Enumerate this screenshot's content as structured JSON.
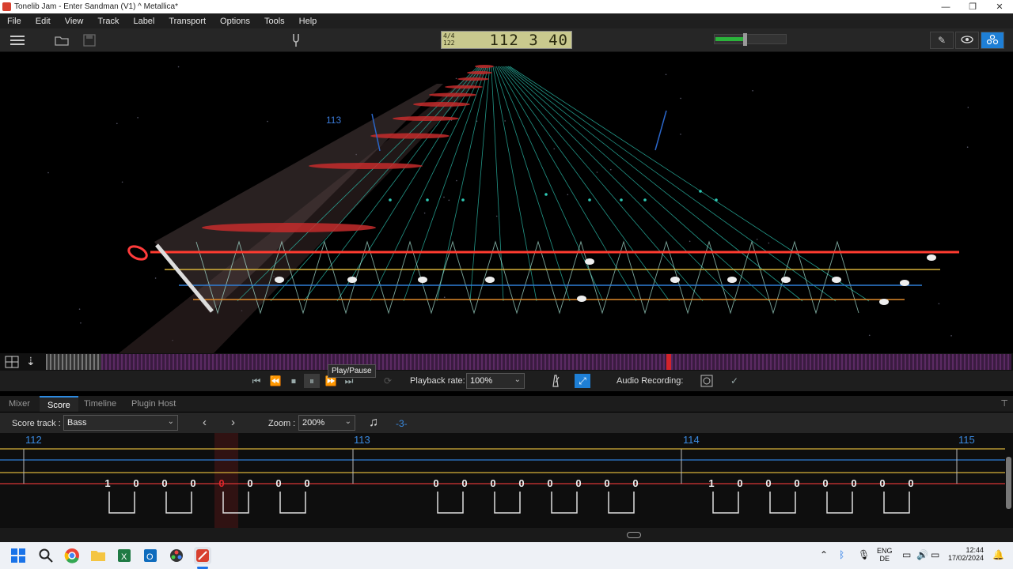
{
  "window": {
    "title": "Tonelib Jam - Enter Sandman (V1) ^ Metallica*"
  },
  "window_controls": {
    "minimize": "—",
    "maximize": "❐",
    "close": "✕"
  },
  "menu": [
    "File",
    "Edit",
    "View",
    "Track",
    "Label",
    "Transport",
    "Options",
    "Tools",
    "Help"
  ],
  "lcd": {
    "time_signature": "4/4",
    "tempo": "122",
    "position": "112 3 40"
  },
  "volume": {
    "level": 0.42
  },
  "view_buttons": [
    "pencil-icon",
    "eye-icon",
    "players-icon"
  ],
  "stage": {
    "measure_label": "113",
    "fret_marker": "0"
  },
  "transport": {
    "tooltip": "Play/Pause",
    "playback_rate_label": "Playback rate:",
    "playback_rate": "100%",
    "audio_recording_label": "Audio Recording:"
  },
  "timeline_strip": {
    "position_fraction": 0.643
  },
  "tabs": [
    "Mixer",
    "Score",
    "Timeline",
    "Plugin Host"
  ],
  "active_tab": "Score",
  "score_bar": {
    "score_track_label": "Score track :",
    "score_track": "Bass",
    "zoom_label": "Zoom :",
    "zoom": "200%",
    "note_value": "-3-"
  },
  "score": {
    "measures": [
      "112",
      "113",
      "114",
      "115"
    ],
    "notes_m112": [
      "1",
      "0",
      "0",
      "0",
      "0",
      "0",
      "0",
      "0"
    ],
    "notes_m113": [
      "0",
      "0",
      "0",
      "0",
      "0",
      "0",
      "0",
      "0"
    ],
    "notes_m114": [
      "1",
      "0",
      "0",
      "0",
      "0",
      "0",
      "0",
      "0"
    ],
    "current_note_color": "#e0262b"
  },
  "taskbar": {
    "apps": [
      "windows-start-icon",
      "search-icon",
      "chrome-icon",
      "file-explorer-icon",
      "excel-icon",
      "outlook-icon",
      "davinci-icon",
      "tonelib-icon"
    ],
    "language": "ENG",
    "layout": "DE",
    "time": "12:44",
    "date": "17/02/2024"
  },
  "colors": {
    "accent": "#1e7fd6",
    "string_red": "#ff3b30",
    "string_yellow": "#d8b23a",
    "string_blue": "#2f7fd8",
    "string_orange": "#e08a2a",
    "fret_teal": "#2ec9b5"
  }
}
